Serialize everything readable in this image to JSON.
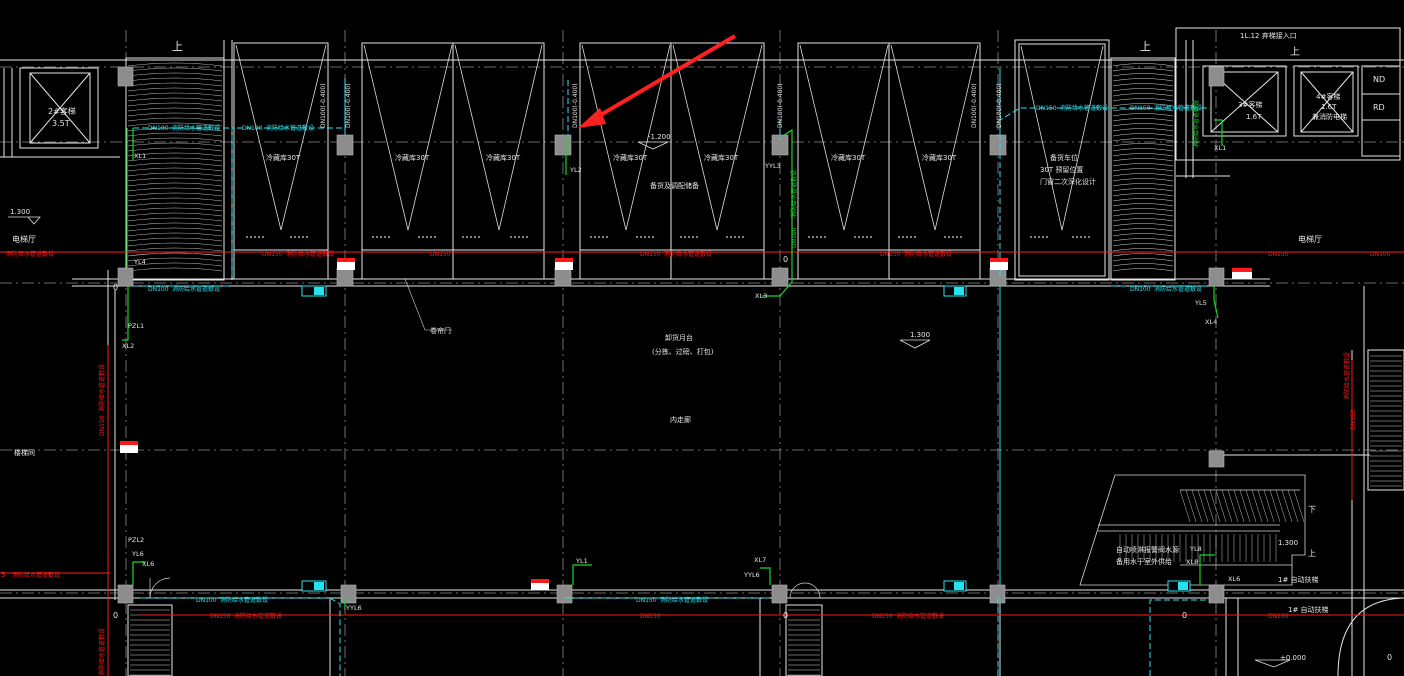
{
  "colors": {
    "background": "#000000",
    "wall": "#e8e8e8",
    "grid": "#9a9a9a",
    "red_pipe": "#ff1a1a",
    "cyan_pipe": "#27e2ee",
    "green_riser": "#19d62a",
    "column": "#8d8d8d"
  },
  "labels": {
    "up_1": "上",
    "up_2": "上",
    "down": "下",
    "up_stair": "上",
    "elev_left": "2#客梯",
    "elev_left_sub": "3.5T",
    "elev_right_1": "3#客梯",
    "elev_right_1_sub": "1.6T",
    "elev_right_2": "4#客梯",
    "elev_right_2_sub": "1.6T",
    "elev_right_2_note": "兼消防电梯",
    "top_right_note": "1L.12 弃梯接入口",
    "room_nd": "ND",
    "room_rd": "RD",
    "cold_room": "冷藏库 30T",
    "cold_note_1": "冷藏库30T",
    "cold_note_2": "冷藏库30T",
    "cold_note_3": "冷藏库30T",
    "cold_note_4": "冷藏库30T",
    "cold_note_5": "冷藏库30T",
    "cold_note_6": "冷藏库30T",
    "cold_note_7": "冷藏库30T",
    "freeze_room_1": "备货车位",
    "freeze_room_2": "30T 预留位置",
    "freeze_room_3": "门窗二次深化设计",
    "center_room": "备货及调配储备",
    "door_label": "卷帘门",
    "platform_1": "卸货月台",
    "platform_2": "(分拣、过磅、打包)",
    "corridor": "内走廊",
    "elev_hall_left": "电梯厅",
    "elev_hall_right": "电梯厅",
    "left_label": "楼梯间",
    "auto_sprinkler_1": "自动喷淋报警阀水源",
    "auto_sprinkler_2": "备用水于室外供给",
    "elev_1_label": "1.300",
    "elev_2_label": "-1.200",
    "elev_3_label": "1.300",
    "elev_4_label": "±0.000",
    "elev_5_label": "1.300",
    "riser_yl1": "YL1",
    "riser_yl2": "YL2",
    "riser_yl3": "YL3",
    "riser_yl4": "YL4",
    "riser_yl5": "YL5",
    "riser_yl6": "YL6",
    "riser_yl7": "YL7",
    "riser_xl1": "XL1",
    "riser_xl2": "XL2",
    "riser_xl3": "XL3",
    "riser_xl4": "XL4",
    "riser_xl6": "XL6",
    "riser_xl7": "XL7",
    "riser_xl8": "XL8",
    "riser_yl8": "YL8",
    "riser_xl6b": "XL6",
    "riser_pzl1": "PZL1",
    "riser_pzl2": "PZL2",
    "riser_yyl6": "YYL6",
    "riser_yyl6b": "YYL6",
    "riser_yyl3": "YYL3",
    "dn_v1": "DN100(-0.400)",
    "dn_v2": "DN100(-0.400)",
    "dn_v3": "DN100(-0.400)",
    "dn_v4": "DN100(-0.400)",
    "dn_v5": "DN100(-0.400)",
    "dn_v6": "DN100(-0.400)",
    "pipe_dn100_a": "DN100",
    "pipe_dn100_b": "DN100",
    "pipe_dn100_c": "DN100",
    "pipe_dn100_d": "DN100",
    "pipe_dn100_e": "DN100",
    "pipe_dn150_a": "DN150",
    "pipe_dn150_b": "DN150",
    "pipe_dn150_c": "DN150",
    "pipe_dn150_d": "DN150",
    "pipe_dn150_e": "DN150",
    "pipe_dn150_f": "DN150",
    "pipe_dn150_g": "DN150",
    "pipe_dn150_h": "DN150",
    "pipe_dn100_red": "DN100",
    "pipe_note": "消防给水管道敷设",
    "pipe_note_b": "消防给水管道敷设",
    "pipe_note_c": "消防给水管道敷设",
    "pipe_note_d": "消防给水管道敷设",
    "pipe_note_e": "消防给水管道敷设",
    "pipe_note_f": "消防给水管道敷设",
    "pipe_note_g": "消防给水管道敷设",
    "pipe_note_h": "消防给水管道敷设",
    "pipe_note_i": "消防给水管道敷设",
    "pipe_note_j": "消防给水管道敷设",
    "pipe_note_k": "消防给水管道敷设",
    "pipe_note_l": "消防给水管道敷设",
    "pipe_note_m": "消防给水管道敷设",
    "pipe_note_n": "消防给水管道敷设",
    "pipe_note_o": "消防给水管道敷设",
    "vert_note_1": "消防给水管道敷设",
    "vert_note_2": "消防给水管道敷设",
    "vert_note_3": "消防给水管道敷设",
    "vert_note_4": "消防给水管道敷设",
    "vert_note_5": "消防给水管道敷设",
    "vert_dn_1": "DN150",
    "vert_dn_2": "DN100",
    "vert_dn_3": "DN150",
    "left_edge_s": "5",
    "stair_note": "1# 自动扶梯",
    "zero_mark_1": "0",
    "zero_mark_2": "0",
    "zero_mark_3": "0",
    "zero_mark_4": "0",
    "zero_mark_5": "0",
    "zero_mark_6": "0",
    "y2": "YL1"
  }
}
